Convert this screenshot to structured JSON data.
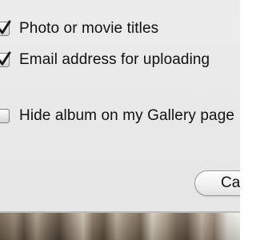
{
  "options": [
    {
      "label": "Photo or movie titles",
      "checked": true
    },
    {
      "label": "Email address for uploading",
      "checked": true
    },
    {
      "label": "Hide album on my Gallery page",
      "checked": false
    }
  ],
  "buttons": {
    "cancel_label": "Cancel"
  },
  "icons": {
    "checkmark": "checkmark-icon"
  }
}
